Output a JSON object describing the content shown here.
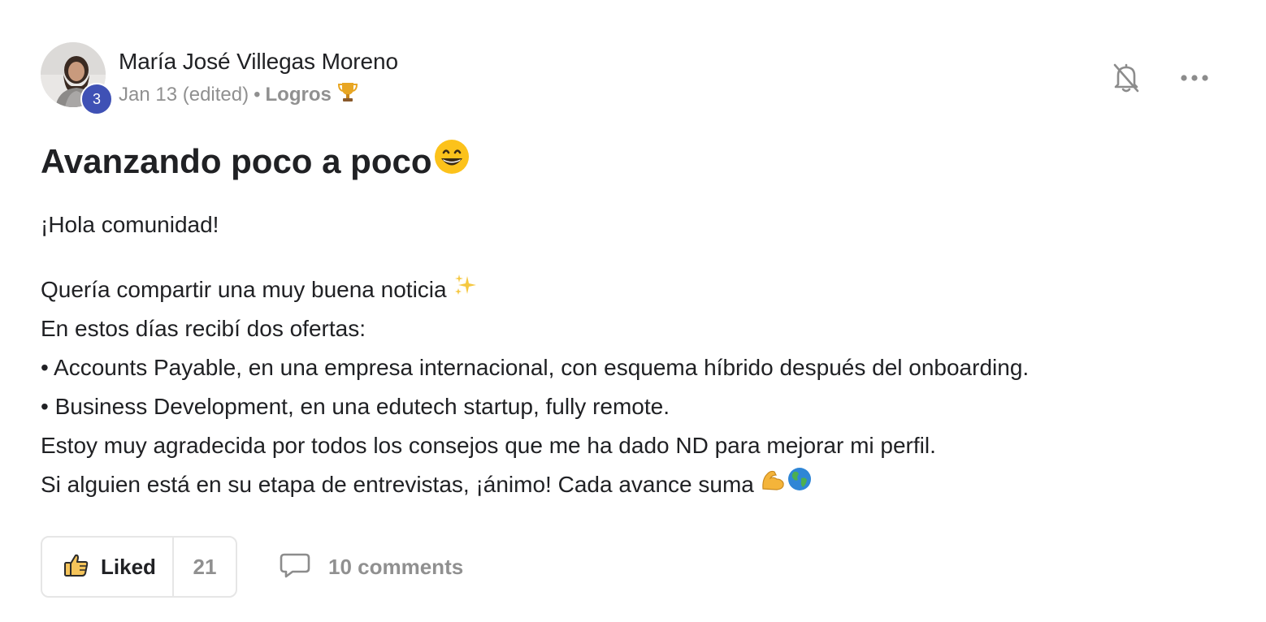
{
  "post": {
    "author": "María José Villegas Moreno",
    "level": "3",
    "date": "Jan 13 (edited)",
    "separator": "•",
    "category": "Logros",
    "title": "Avanzando poco a poco",
    "greeting": "¡Hola comunidad!",
    "lines": [
      "Quería compartir una muy buena noticia",
      "En estos días recibí dos ofertas:",
      "• Accounts Payable, en una empresa internacional, con esquema híbrido después del onboarding.",
      "• Business Development, en una edutech startup, fully remote.",
      "Estoy muy agradecida por todos los consejos que me ha dado ND para mejorar mi perfil.",
      "Si alguien está en su etapa de entrevistas, ¡ánimo! Cada avance suma"
    ]
  },
  "actions": {
    "like_label": "Liked",
    "like_count": "21",
    "comments_label": "10 comments"
  },
  "icons": {
    "notifications": "bell-off-icon",
    "more": "more-horizontal-icon",
    "like": "thumbs-up-icon",
    "comment": "comment-icon",
    "trophy": "trophy-icon",
    "title_emoji": "grinning-face-icon",
    "sparkles": "sparkles-icon",
    "muscle": "flexed-biceps-icon",
    "globe": "globe-icon"
  },
  "colors": {
    "badge": "#3f51b5",
    "muted": "#909090",
    "text": "#202124",
    "border": "#e6e6e6"
  }
}
